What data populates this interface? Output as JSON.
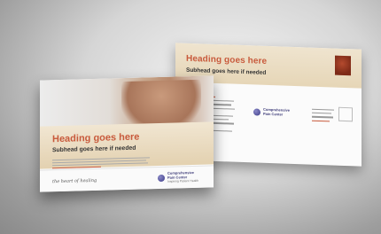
{
  "front_card": {
    "heading": "Heading goes here",
    "subhead": "Subhead goes here if needed",
    "tagline": "the heart of healing",
    "logo_name": "Comprehensive Pain Center",
    "logo_sub": "Inspiring Patient Health"
  },
  "back_card": {
    "heading": "Heading goes here",
    "subhead": "Subhead goes here if needed",
    "logo_name": "Comprehensive Pain Center"
  }
}
